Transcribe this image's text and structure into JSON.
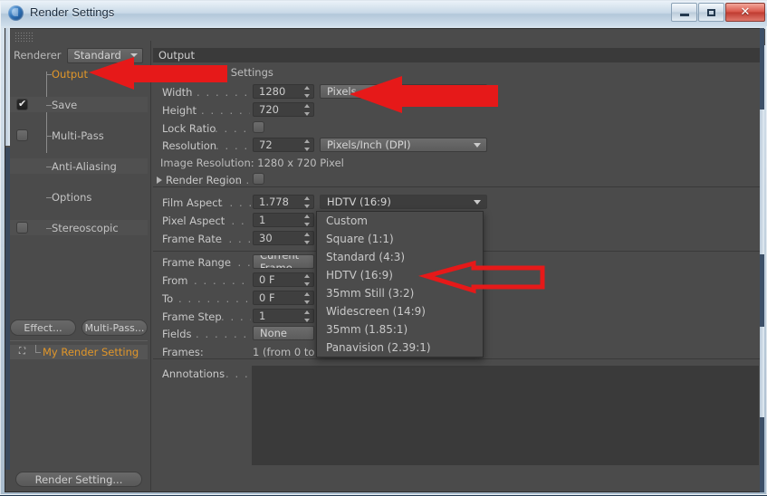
{
  "window": {
    "title": "Render Settings",
    "app_icon": "c4d-logo-icon",
    "buttons": {
      "minimize": "–",
      "maximize": "❐",
      "close": "✕"
    }
  },
  "renderer": {
    "label": "Renderer",
    "value": "Standard"
  },
  "tree": {
    "items": [
      {
        "label": "Output",
        "checkbox": "none",
        "selected": true
      },
      {
        "label": "Save",
        "checkbox": "checked",
        "selected": false
      },
      {
        "label": "Multi-Pass",
        "checkbox": "empty",
        "selected": false
      },
      {
        "label": "Anti-Aliasing",
        "checkbox": "none",
        "selected": false
      },
      {
        "label": "Options",
        "checkbox": "none",
        "selected": false
      },
      {
        "label": "Stereoscopic",
        "checkbox": "empty",
        "selected": false
      }
    ],
    "buttons": {
      "effect": "Effect...",
      "multipass": "Multi-Pass..."
    },
    "preset": "My Render Setting",
    "bottom_button": "Render Setting..."
  },
  "output": {
    "header": "Output",
    "custom_settings": "Custom Settings",
    "fields": {
      "width": {
        "label": "Width",
        "dots": ". . . . . . . . .",
        "value": "1280",
        "unit": "Pixels"
      },
      "height": {
        "label": "Height",
        "dots": ". . . . . . . . .",
        "value": "720"
      },
      "lock_ratio": {
        "label": "Lock Ratio",
        "dots": ". . . . . .",
        "value": "off"
      },
      "resolution": {
        "label": "Resolution",
        "dots": ". . . . . .",
        "value": "72",
        "unit": "Pixels/Inch (DPI)"
      }
    },
    "image_resolution": "Image Resolution: 1280 x 720 Pixel",
    "render_region": {
      "label": "Render Region",
      "dots": ". .",
      "value": "off"
    }
  },
  "aspect": {
    "film_aspect": {
      "label": "Film Aspect",
      "dots": ". . . . .",
      "value": "1.778",
      "preset": "HDTV (16:9)"
    },
    "pixel_aspect": {
      "label": "Pixel Aspect",
      "dots": ". . . . .",
      "value": "1"
    },
    "frame_rate": {
      "label": "Frame Rate",
      "dots": ". . . . . .",
      "value": "30"
    }
  },
  "frames": {
    "frame_range": {
      "label": "Frame Range",
      "dots": ". . . .",
      "value": "Current Frame"
    },
    "from": {
      "label": "From",
      "dots": ". . . . . . . . . .",
      "value": "0 F"
    },
    "to": {
      "label": "To",
      "dots": ". . . . . . . . . . . .",
      "value": "0 F"
    },
    "frame_step": {
      "label": "Frame Step",
      "dots": ". . . . . .",
      "value": "1"
    },
    "fields": {
      "label": "Fields",
      "dots": ". . . . . . . . . .",
      "value": "None"
    },
    "frames_count": {
      "label": "Frames:",
      "value": "1 (from 0 to 0)"
    }
  },
  "annotations": {
    "label": "Annotations",
    "dots": ". . . .",
    "value": ""
  },
  "dropdown": {
    "open": true,
    "selected": "HDTV (16:9)",
    "options": [
      "Custom",
      "Square (1:1)",
      "Standard (4:3)",
      "HDTV (16:9)",
      "35mm Still (3:2)",
      "Widescreen (14:9)",
      "35mm (1.85:1)",
      "Panavision (2.39:1)"
    ]
  },
  "callouts": {
    "color": "#e61919",
    "items": [
      {
        "name": "arrow-to-output-tree-item",
        "points_to": "Output"
      },
      {
        "name": "arrow-to-pixels-unit-dropdown",
        "points_to": "Pixels"
      },
      {
        "name": "arrow-to-hdtv-option",
        "points_to": "HDTV (16:9)"
      }
    ]
  }
}
